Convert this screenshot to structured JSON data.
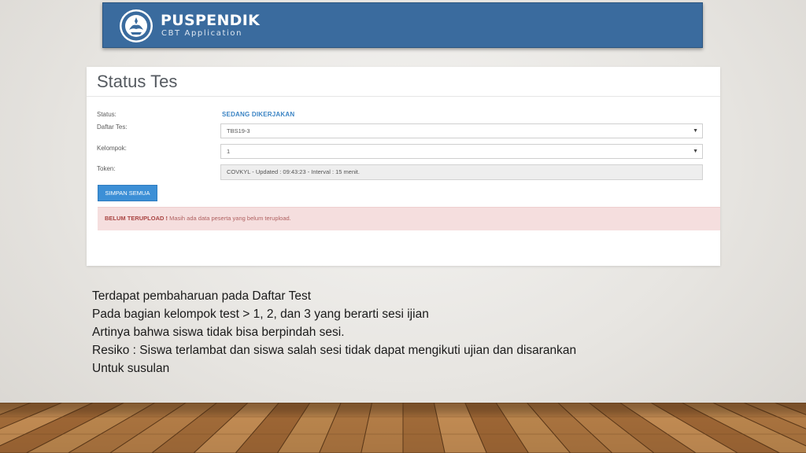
{
  "header": {
    "app_name": "PUSPENDIK",
    "app_subtitle": "CBT Application",
    "logo_icon": "tut-wuri-handayani-emblem-icon",
    "background_color": "#3a6b9e"
  },
  "panel": {
    "title": "Status Tes",
    "fields": {
      "status_label": "Status:",
      "status_value": "SEDANG DIKERJAKAN",
      "daftar_tes_label": "Daftar Tes:",
      "daftar_tes_value": "TBS19-3",
      "kelompok_label": "Kelompok:",
      "kelompok_value": "1",
      "token_label": "Token:",
      "token_value": "COVKYL - Updated : 09:43:23 - Interval : 15 menit."
    },
    "save_button": "SIMPAN SEMUA",
    "alert": {
      "strong": "BELUM TERUPLOAD !",
      "message": " Masih ada data peserta yang belum terupload."
    },
    "accent_color": "#3c8fd6",
    "alert_color": "#f5dede"
  },
  "description": {
    "line1": "Terdapat pembaharuan pada Daftar Test",
    "line2": "Pada bagian kelompok test > 1, 2, dan 3 yang berarti sesi ijian",
    "line3": "Artinya bahwa siswa tidak bisa berpindah sesi.",
    "line4": "Resiko : Siswa terlambat dan siswa salah sesi tidak dapat mengikuti ujian dan disarankan",
    "line5": "Untuk susulan"
  }
}
